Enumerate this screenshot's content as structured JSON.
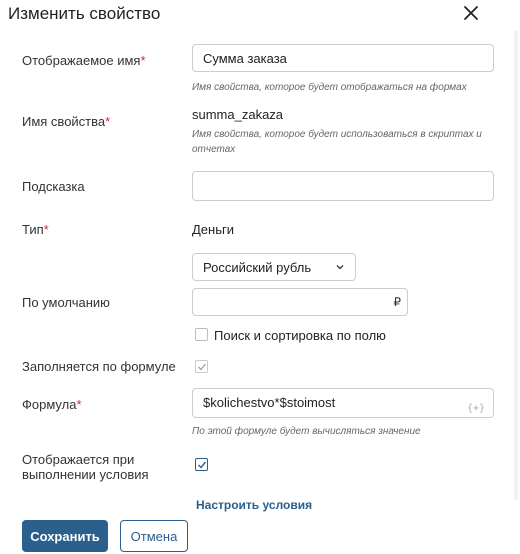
{
  "dialog": {
    "title": "Изменить свойство",
    "close_icon": "close-icon"
  },
  "fields": {
    "display_name": {
      "label": "Отображаемое имя",
      "required_mark": "*",
      "value": "Сумма заказа",
      "hint": "Имя свойства, которое будет отображаться на формах"
    },
    "property_name": {
      "label": "Имя свойства",
      "required_mark": "*",
      "value": "summa_zakaza",
      "hint_line1": "Имя свойства, которое будет использоваться в скриптах и",
      "hint_line2": "отчетах"
    },
    "tooltip": {
      "label": "Подсказка",
      "value": ""
    },
    "type": {
      "label": "Тип",
      "required_mark": "*",
      "value": "Деньги",
      "currency_select": "Российский рубль"
    },
    "default_value": {
      "label": "По умолчанию",
      "value": "",
      "currency_symbol": "₽"
    },
    "search_sort": {
      "label": "Поиск и сортировка по полю",
      "checked": false
    },
    "filled_by_formula": {
      "label": "Заполняется по формуле",
      "checked": true
    },
    "formula": {
      "label": "Формула",
      "required_mark": "*",
      "value": "$kolichestvo*$stoimost",
      "icon_text": "{+}",
      "hint": "По этой формуле будет вычисляться значение"
    },
    "conditional_display": {
      "label_line1": "Отображается при",
      "label_line2": "выполнении условия",
      "checked": true
    },
    "configure_conditions_link": "Настроить условия"
  },
  "buttons": {
    "save": "Сохранить",
    "cancel": "Отмена"
  },
  "colors": {
    "accent": "#2b5f8c",
    "required": "#d9262e"
  }
}
